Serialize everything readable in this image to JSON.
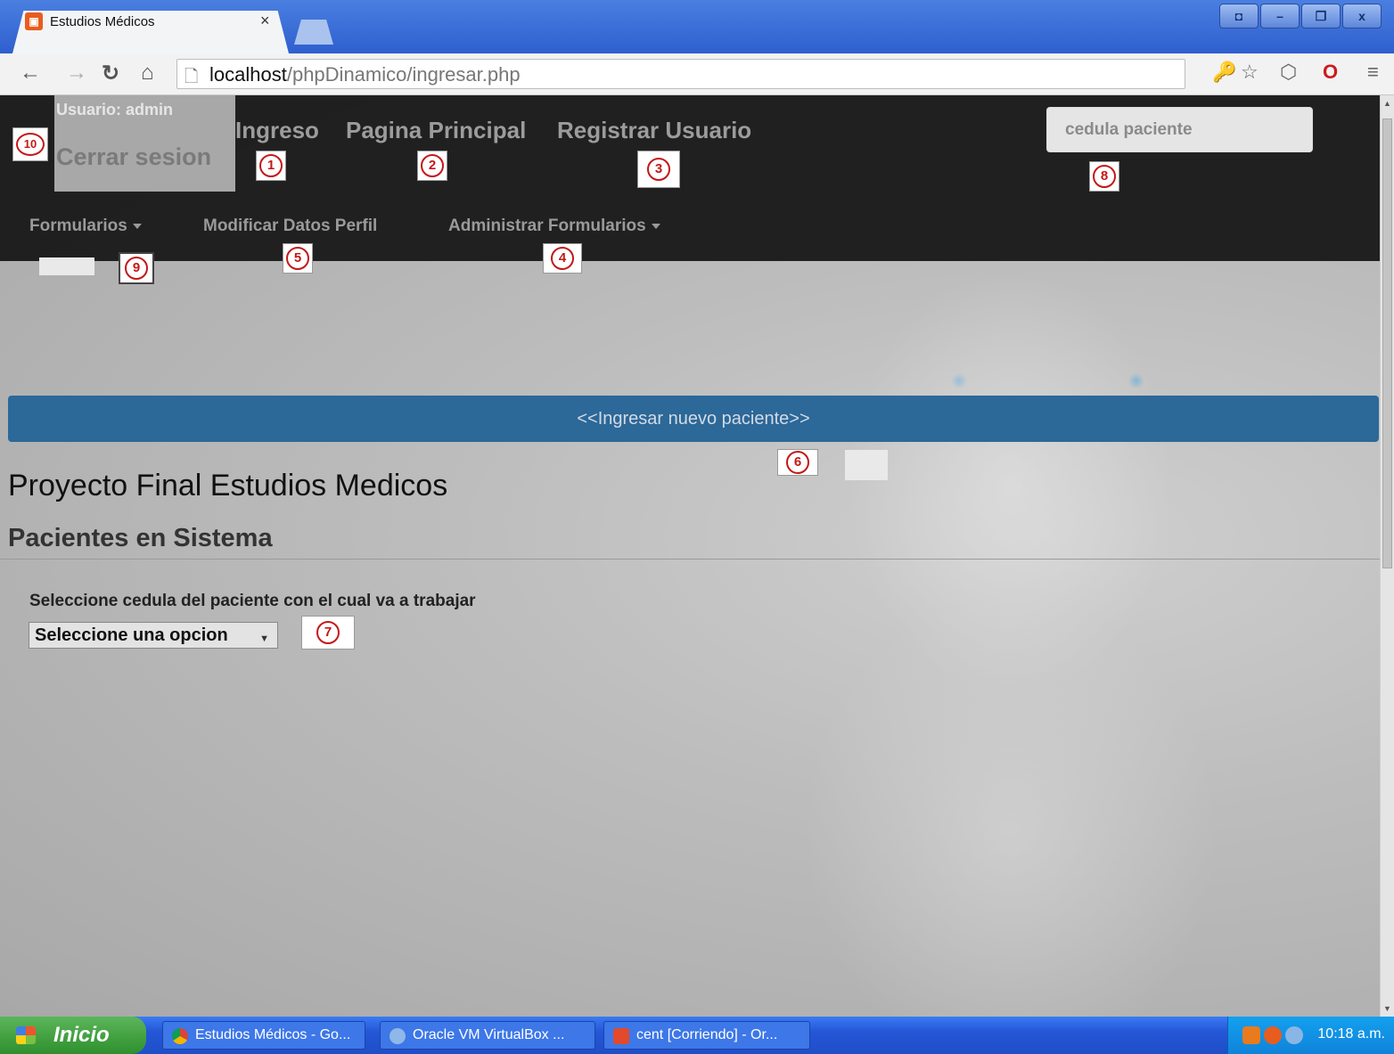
{
  "browser": {
    "tab_title": "Estudios Médicos",
    "tab_close": "×",
    "url_host": "localhost",
    "url_path": "/phpDinamico/ingresar.php",
    "window_buttons": [
      "◘",
      "–",
      "❐",
      "x"
    ]
  },
  "navbar": {
    "user_label": "Usuario: admin",
    "logout": "Cerrar sesion",
    "links": [
      "Ingreso",
      "Pagina Principal",
      "Registrar Usuario"
    ],
    "search_placeholder": "cedula paciente",
    "subnav": [
      "Formularios",
      "Modificar Datos Perfil",
      "Administrar Formularios"
    ]
  },
  "markers": [
    "1",
    "2",
    "3",
    "4",
    "5",
    "6",
    "7",
    "8",
    "9",
    "10"
  ],
  "main": {
    "new_patient_button": "<<Ingresar nuevo paciente>>",
    "title": "Proyecto Final Estudios Medicos",
    "subtitle": "Pacientes en Sistema",
    "select_label": "Seleccione cedula del paciente con el cual va a trabajar",
    "select_value": "Seleccione una opcion"
  },
  "taskbar": {
    "start": "Inicio",
    "items": [
      "Estudios Médicos - Go...",
      "Oracle VM VirtualBox ...",
      "cent [Corriendo] - Or..."
    ],
    "clock": "10:18 a.m."
  }
}
